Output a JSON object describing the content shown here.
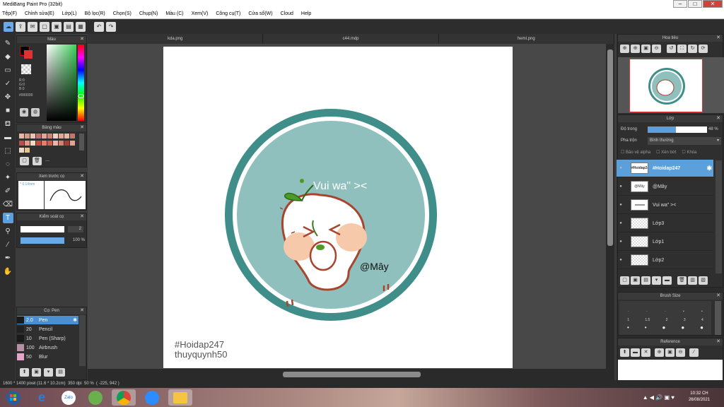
{
  "window": {
    "title": "MediBang Paint Pro (32bit)",
    "buttons": [
      "–",
      "□",
      "✕"
    ]
  },
  "menu": [
    "Tệp(F)",
    "Chỉnh sửa(E)",
    "Lớp(L)",
    "Bộ lọc(R)",
    "Chọn(S)",
    "Chụp(N)",
    "Màu (C)",
    "Xem(V)",
    "Công cụ(T)",
    "Cửa sổ(W)",
    "Cloud",
    "Help"
  ],
  "tabs": [
    "kda.png",
    "c44.mdp",
    "heml.png"
  ],
  "color_panel": {
    "title": "Màu",
    "r": "R:0",
    "g": "G:0",
    "b": "B:0",
    "hex": "#000000"
  },
  "palette_panel": {
    "title": "Bảng màu",
    "dash": "---"
  },
  "preview_panel": {
    "title": "Xem trước cọ",
    "size": "* 0.14mm"
  },
  "brush_control": {
    "title": "Kiểm soát cọ",
    "size": "2",
    "opacity": "100 %"
  },
  "brush_panel": {
    "title": "Cọ: Pen",
    "brushes": [
      {
        "size": "2.0",
        "name": "Pen",
        "color": "#1a1a1a"
      },
      {
        "size": "20",
        "name": "Pencil",
        "color": "#222222"
      },
      {
        "size": "10",
        "name": "Pen (Sharp)",
        "color": "#1a1a1a"
      },
      {
        "size": "100",
        "name": "Airbrush",
        "color": "#b98fa6"
      },
      {
        "size": "50",
        "name": "Blur",
        "color": "#e4a6c8"
      }
    ]
  },
  "navigator": {
    "title": "Hoa tiêu"
  },
  "layer_panel": {
    "title": "Lớp",
    "opacity_label": "Độ trong",
    "opacity_value": "48 %",
    "opacity_fraction": 0.48,
    "blend_label": "Pha trộn",
    "blend_value": "Bình thường",
    "protect_alpha": "Bảo vệ alpha",
    "clipping": "Xén bớt",
    "lock": "Khóa",
    "layers": [
      {
        "name": "#Hoidap247",
        "thumb": "#Hoidap247",
        "selected": true
      },
      {
        "name": "@Mây",
        "thumb": "@Mây",
        "selected": false
      },
      {
        "name": "Vui wa\"  ><",
        "thumb": "",
        "selected": false
      },
      {
        "name": "Lớp3",
        "thumb": "",
        "selected": false
      },
      {
        "name": "Lớp1",
        "thumb": "",
        "selected": false
      },
      {
        "name": "Lớp2",
        "thumb": "",
        "selected": false
      }
    ]
  },
  "brush_size_panel": {
    "title": "Brush Size",
    "row1": [
      "1",
      "1.5",
      "2",
      "3",
      "4"
    ]
  },
  "reference_panel": {
    "title": "Reference"
  },
  "artwork": {
    "text_top": "Vui wa\"  ><",
    "text_name": "@Mây",
    "watermark1": "#Hoidap247",
    "watermark2": "thuyquynh50"
  },
  "status": {
    "size": "1600 * 1400 pixel",
    "cm": "(11.6 * 10.2cm)",
    "dpi": "350 dpi",
    "zoom": "50 %",
    "coords": "( -225, 942 )"
  },
  "taskbar": {
    "time": "10:32 CH",
    "date": "26/08/2021"
  },
  "colors": {
    "accent": "#5b9fdb",
    "badge_teal": "#3f8e8a",
    "badge_inner": "#8fc0bd"
  }
}
